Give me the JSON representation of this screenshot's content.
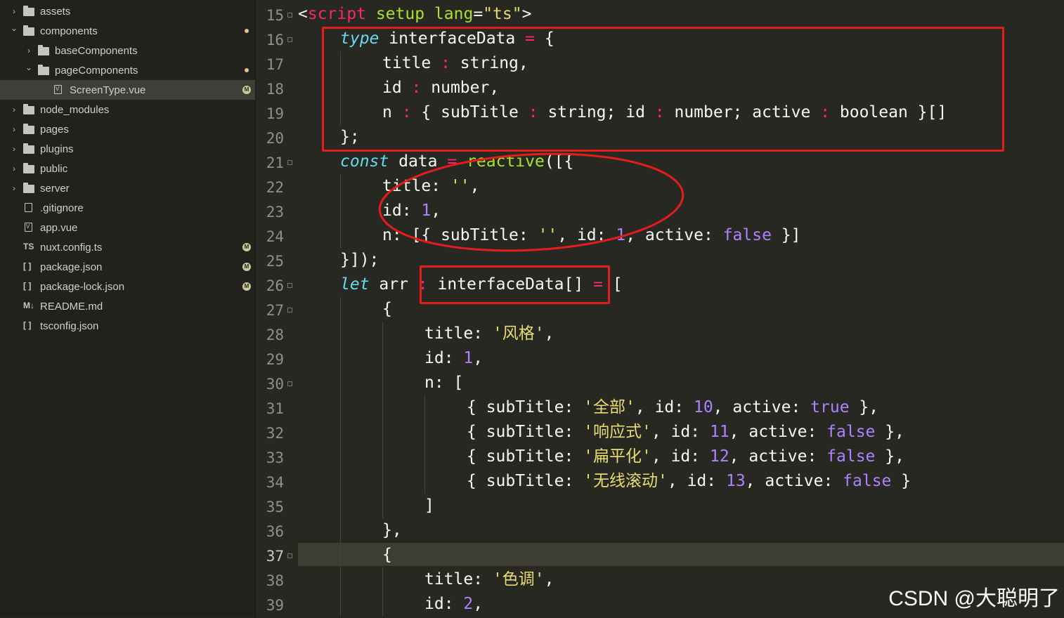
{
  "sidebar": {
    "items": [
      {
        "label": "assets",
        "type": "folder",
        "expanded": false,
        "indent": 0
      },
      {
        "label": "components",
        "type": "folder",
        "expanded": true,
        "indent": 0,
        "modified_dot": true
      },
      {
        "label": "baseComponents",
        "type": "folder",
        "expanded": false,
        "indent": 1
      },
      {
        "label": "pageComponents",
        "type": "folder",
        "expanded": true,
        "indent": 1,
        "modified_dot": true
      },
      {
        "label": "ScreenType.vue",
        "type": "vue-file",
        "indent": 2,
        "selected": true,
        "badge": "M"
      },
      {
        "label": "node_modules",
        "type": "folder",
        "expanded": false,
        "indent": 0
      },
      {
        "label": "pages",
        "type": "folder",
        "expanded": false,
        "indent": 0
      },
      {
        "label": "plugins",
        "type": "folder",
        "expanded": false,
        "indent": 0
      },
      {
        "label": "public",
        "type": "folder",
        "expanded": false,
        "indent": 0
      },
      {
        "label": "server",
        "type": "folder",
        "expanded": false,
        "indent": 0
      },
      {
        "label": ".gitignore",
        "type": "file",
        "indent": 0
      },
      {
        "label": "app.vue",
        "type": "vue-file",
        "indent": 0
      },
      {
        "label": "nuxt.config.ts",
        "type": "ts-file",
        "icon_text": "TS",
        "indent": 0,
        "badge": "M"
      },
      {
        "label": "package.json",
        "type": "json-file",
        "icon_text": "[ ]",
        "indent": 0,
        "badge": "M"
      },
      {
        "label": "package-lock.json",
        "type": "json-file",
        "icon_text": "[ ]",
        "indent": 0,
        "badge": "M"
      },
      {
        "label": "README.md",
        "type": "md-file",
        "icon_text": "M↓",
        "indent": 0
      },
      {
        "label": "tsconfig.json",
        "type": "json-file",
        "icon_text": "[ ]",
        "indent": 0
      }
    ]
  },
  "editor": {
    "line_numbers": [
      "15",
      "16",
      "17",
      "18",
      "19",
      "20",
      "21",
      "22",
      "23",
      "24",
      "25",
      "26",
      "27",
      "28",
      "29",
      "30",
      "31",
      "32",
      "33",
      "34",
      "35",
      "36",
      "37",
      "38",
      "39"
    ],
    "fold_markers_on": [
      "15",
      "16",
      "21",
      "26",
      "27",
      "30",
      "37"
    ],
    "active_line": "37",
    "lines": [
      {
        "indent": 0,
        "tokens": [
          [
            "p",
            "<"
          ],
          [
            "kw",
            "script"
          ],
          [
            "p",
            " "
          ],
          [
            "attr",
            "setup"
          ],
          [
            "p",
            " "
          ],
          [
            "attr",
            "lang"
          ],
          [
            "p",
            "="
          ],
          [
            "str",
            "\"ts\""
          ],
          [
            "p",
            ">"
          ]
        ]
      },
      {
        "indent": 1,
        "tokens": [
          [
            "kwi",
            "type"
          ],
          [
            "p",
            " interfaceData "
          ],
          [
            "op",
            "="
          ],
          [
            "p",
            " {"
          ]
        ]
      },
      {
        "indent": 2,
        "tokens": [
          [
            "p",
            "title "
          ],
          [
            "op",
            ":"
          ],
          [
            "p",
            " string,"
          ]
        ]
      },
      {
        "indent": 2,
        "tokens": [
          [
            "p",
            "id "
          ],
          [
            "op",
            ":"
          ],
          [
            "p",
            " number,"
          ]
        ]
      },
      {
        "indent": 2,
        "tokens": [
          [
            "p",
            "n "
          ],
          [
            "op",
            ":"
          ],
          [
            "p",
            " { subTitle "
          ],
          [
            "op",
            ":"
          ],
          [
            "p",
            " string; id "
          ],
          [
            "op",
            ":"
          ],
          [
            "p",
            " number; active "
          ],
          [
            "op",
            ":"
          ],
          [
            "p",
            " boolean }[]"
          ]
        ]
      },
      {
        "indent": 1,
        "tokens": [
          [
            "p",
            "};"
          ]
        ]
      },
      {
        "indent": 1,
        "tokens": [
          [
            "kwi",
            "const"
          ],
          [
            "p",
            " data "
          ],
          [
            "op",
            "="
          ],
          [
            "p",
            " "
          ],
          [
            "fn",
            "reactive"
          ],
          [
            "p",
            "([{"
          ]
        ]
      },
      {
        "indent": 2,
        "tokens": [
          [
            "p",
            "title: "
          ],
          [
            "str",
            "''"
          ],
          [
            "p",
            ","
          ]
        ]
      },
      {
        "indent": 2,
        "tokens": [
          [
            "p",
            "id: "
          ],
          [
            "num",
            "1"
          ],
          [
            "p",
            ","
          ]
        ]
      },
      {
        "indent": 2,
        "tokens": [
          [
            "p",
            "n: [{ subTitle: "
          ],
          [
            "str",
            "''"
          ],
          [
            "p",
            ", id: "
          ],
          [
            "num",
            "1"
          ],
          [
            "p",
            ", active: "
          ],
          [
            "num",
            "false"
          ],
          [
            "p",
            " }]"
          ]
        ]
      },
      {
        "indent": 1,
        "tokens": [
          [
            "p",
            "}]);"
          ]
        ]
      },
      {
        "indent": 1,
        "tokens": [
          [
            "kwi",
            "let"
          ],
          [
            "p",
            " arr "
          ],
          [
            "op",
            ":"
          ],
          [
            "p",
            " interfaceData[] "
          ],
          [
            "op",
            "="
          ],
          [
            "p",
            " ["
          ]
        ]
      },
      {
        "indent": 2,
        "tokens": [
          [
            "p",
            "{"
          ]
        ]
      },
      {
        "indent": 3,
        "tokens": [
          [
            "p",
            "title: "
          ],
          [
            "str",
            "'风格'"
          ],
          [
            "p",
            ","
          ]
        ]
      },
      {
        "indent": 3,
        "tokens": [
          [
            "p",
            "id: "
          ],
          [
            "num",
            "1"
          ],
          [
            "p",
            ","
          ]
        ]
      },
      {
        "indent": 3,
        "tokens": [
          [
            "p",
            "n: ["
          ]
        ]
      },
      {
        "indent": 4,
        "tokens": [
          [
            "p",
            "{ subTitle: "
          ],
          [
            "str",
            "'全部'"
          ],
          [
            "p",
            ", id: "
          ],
          [
            "num",
            "10"
          ],
          [
            "p",
            ", active: "
          ],
          [
            "num",
            "true"
          ],
          [
            "p",
            " },"
          ]
        ]
      },
      {
        "indent": 4,
        "tokens": [
          [
            "p",
            "{ subTitle: "
          ],
          [
            "str",
            "'响应式'"
          ],
          [
            "p",
            ", id: "
          ],
          [
            "num",
            "11"
          ],
          [
            "p",
            ", active: "
          ],
          [
            "num",
            "false"
          ],
          [
            "p",
            " },"
          ]
        ]
      },
      {
        "indent": 4,
        "tokens": [
          [
            "p",
            "{ subTitle: "
          ],
          [
            "str",
            "'扁平化'"
          ],
          [
            "p",
            ", id: "
          ],
          [
            "num",
            "12"
          ],
          [
            "p",
            ", active: "
          ],
          [
            "num",
            "false"
          ],
          [
            "p",
            " },"
          ]
        ]
      },
      {
        "indent": 4,
        "tokens": [
          [
            "p",
            "{ subTitle: "
          ],
          [
            "str",
            "'无线滚动'"
          ],
          [
            "p",
            ", id: "
          ],
          [
            "num",
            "13"
          ],
          [
            "p",
            ", active: "
          ],
          [
            "num",
            "false"
          ],
          [
            "p",
            " }"
          ]
        ]
      },
      {
        "indent": 3,
        "tokens": [
          [
            "p",
            "]"
          ]
        ]
      },
      {
        "indent": 2,
        "tokens": [
          [
            "p",
            "},"
          ]
        ]
      },
      {
        "indent": 2,
        "tokens": [
          [
            "p",
            "{"
          ]
        ]
      },
      {
        "indent": 3,
        "tokens": [
          [
            "p",
            "title: "
          ],
          [
            "str",
            "'色调'"
          ],
          [
            "p",
            ","
          ]
        ]
      },
      {
        "indent": 3,
        "tokens": [
          [
            "p",
            "id: "
          ],
          [
            "num",
            "2"
          ],
          [
            "p",
            ","
          ]
        ]
      }
    ]
  },
  "colors": {
    "editor_bg": "#272822",
    "sidebar_bg": "#21221d",
    "keyword_pink": "#f92672",
    "keyword_cyan": "#66d9ef",
    "function_green": "#a6e22e",
    "string_yellow": "#e6db74",
    "number_purple": "#ae81ff",
    "annotation_red": "#e51c1c"
  },
  "watermark": "CSDN @大聪明了"
}
